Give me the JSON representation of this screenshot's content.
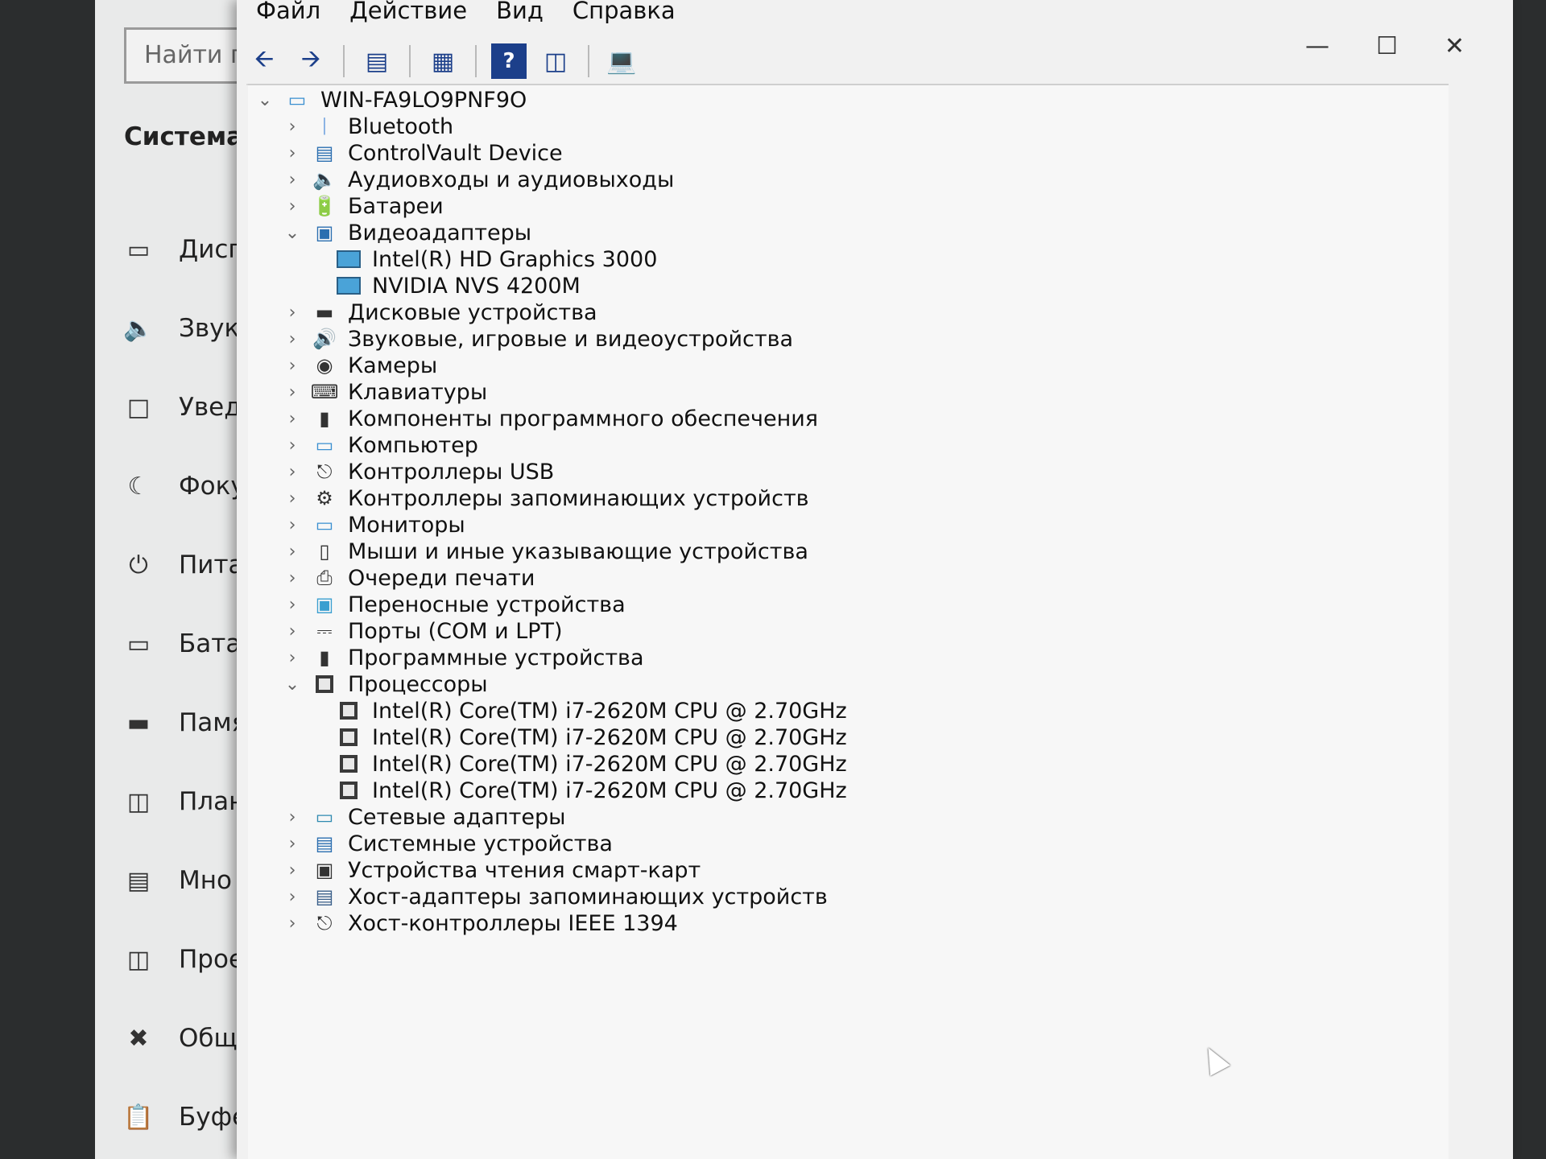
{
  "settings": {
    "search_placeholder": "Найти п",
    "section_title": "Система",
    "nav": [
      {
        "label": "Дисп",
        "icon": "display-icon"
      },
      {
        "label": "Звук",
        "icon": "speaker-icon"
      },
      {
        "label": "Увед",
        "icon": "notifications-icon"
      },
      {
        "label": "Фоку",
        "icon": "focus-assist-icon"
      },
      {
        "label": "Пита",
        "icon": "power-icon"
      },
      {
        "label": "Батар",
        "icon": "battery-icon"
      },
      {
        "label": "Памя",
        "icon": "storage-icon"
      },
      {
        "label": "План",
        "icon": "tablet-icon"
      },
      {
        "label": "Мно",
        "icon": "multitasking-icon"
      },
      {
        "label": "Прое",
        "icon": "projecting-icon"
      },
      {
        "label": "Общ",
        "icon": "shared-experiences-icon"
      },
      {
        "label": "Буфе",
        "icon": "clipboard-icon"
      }
    ]
  },
  "devmgr": {
    "menu": [
      "Файл",
      "Действие",
      "Вид",
      "Справка"
    ],
    "root": "WIN-FA9LO9PNF9O",
    "categories": [
      {
        "label": "Bluetooth",
        "expanded": false,
        "icon": "bluetooth-icon"
      },
      {
        "label": "ControlVault Device",
        "expanded": false,
        "icon": "controlvault-icon"
      },
      {
        "label": "Аудиовходы и аудиовыходы",
        "expanded": false,
        "icon": "audio-io-icon"
      },
      {
        "label": "Батареи",
        "expanded": false,
        "icon": "battery-icon"
      },
      {
        "label": "Видеоадаптеры",
        "expanded": true,
        "icon": "display-adapter-icon",
        "children": [
          "Intel(R) HD Graphics 3000",
          "NVIDIA NVS 4200M"
        ]
      },
      {
        "label": "Дисковые устройства",
        "expanded": false,
        "icon": "disk-icon"
      },
      {
        "label": "Звуковые, игровые и видеоустройства",
        "expanded": false,
        "icon": "sound-icon"
      },
      {
        "label": "Камеры",
        "expanded": false,
        "icon": "camera-icon"
      },
      {
        "label": "Клавиатуры",
        "expanded": false,
        "icon": "keyboard-icon"
      },
      {
        "label": "Компоненты программного обеспечения",
        "expanded": false,
        "icon": "software-component-icon"
      },
      {
        "label": "Компьютер",
        "expanded": false,
        "icon": "computer-icon"
      },
      {
        "label": "Контроллеры USB",
        "expanded": false,
        "icon": "usb-icon"
      },
      {
        "label": "Контроллеры запоминающих устройств",
        "expanded": false,
        "icon": "storage-controller-icon"
      },
      {
        "label": "Мониторы",
        "expanded": false,
        "icon": "monitor-icon"
      },
      {
        "label": "Мыши и иные указывающие устройства",
        "expanded": false,
        "icon": "mouse-icon"
      },
      {
        "label": "Очереди печати",
        "expanded": false,
        "icon": "printer-icon"
      },
      {
        "label": "Переносные устройства",
        "expanded": false,
        "icon": "portable-device-icon"
      },
      {
        "label": "Порты (COM и LPT)",
        "expanded": false,
        "icon": "port-icon"
      },
      {
        "label": "Программные устройства",
        "expanded": false,
        "icon": "software-device-icon"
      },
      {
        "label": "Процессоры",
        "expanded": true,
        "icon": "processor-icon",
        "children": [
          "Intel(R) Core(TM) i7-2620M CPU @ 2.70GHz",
          "Intel(R) Core(TM) i7-2620M CPU @ 2.70GHz",
          "Intel(R) Core(TM) i7-2620M CPU @ 2.70GHz",
          "Intel(R) Core(TM) i7-2620M CPU @ 2.70GHz"
        ]
      },
      {
        "label": "Сетевые адаптеры",
        "expanded": false,
        "icon": "network-icon"
      },
      {
        "label": "Системные устройства",
        "expanded": false,
        "icon": "system-device-icon"
      },
      {
        "label": "Устройства чтения смарт-карт",
        "expanded": false,
        "icon": "smartcard-icon"
      },
      {
        "label": "Хост-адаптеры запоминающих устройств",
        "expanded": false,
        "icon": "storage-host-icon"
      },
      {
        "label": "Хост-контроллеры IEEE 1394",
        "expanded": false,
        "icon": "ieee1394-icon"
      }
    ]
  }
}
